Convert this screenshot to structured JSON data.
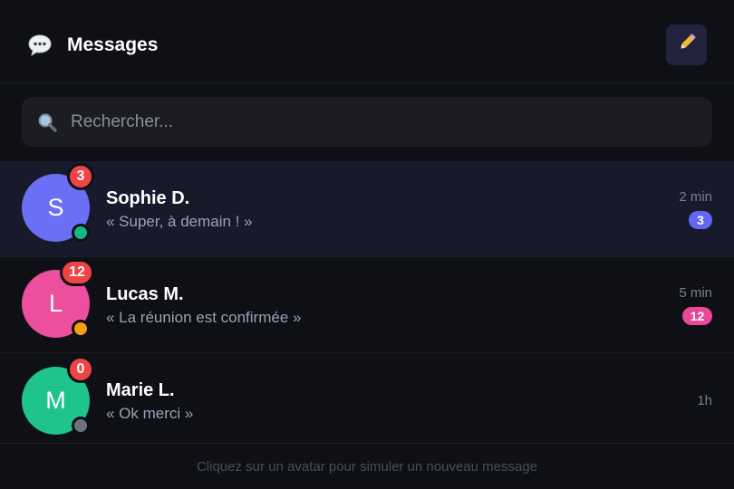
{
  "header": {
    "title": "Messages",
    "icon": "speech-bubble-icon",
    "compose_icon": "pencil-icon"
  },
  "search": {
    "placeholder": "Rechercher...",
    "value": "",
    "icon": "magnifier-icon"
  },
  "conversations": [
    {
      "initial": "S",
      "name": "Sophie D.",
      "preview": "« Super, à demain ! »",
      "time": "2 min",
      "badge_count": "3",
      "unread_count": "3",
      "avatar_color": "#6b6ff5",
      "unread_color": "#6366f1",
      "status": "online",
      "status_color": "#10b981",
      "selected": true
    },
    {
      "initial": "L",
      "name": "Lucas M.",
      "preview": "« La réunion est confirmée »",
      "time": "5 min",
      "badge_count": "12",
      "unread_count": "12",
      "avatar_color": "#ec4f9c",
      "unread_color": "#ec4899",
      "status": "away",
      "status_color": "#f59e0b",
      "selected": false
    },
    {
      "initial": "M",
      "name": "Marie L.",
      "preview": "« Ok merci »",
      "time": "1h",
      "badge_count": "0",
      "unread_count": "",
      "avatar_color": "#1ec48c",
      "status": "offline",
      "status_color": "#6b7280",
      "selected": false
    }
  ],
  "footer": {
    "hint": "Cliquez sur un avatar pour simuler un nouveau message"
  },
  "colors": {
    "background": "#0f1016",
    "badge_red": "#ef4444",
    "selected_row": "#171a2b"
  }
}
